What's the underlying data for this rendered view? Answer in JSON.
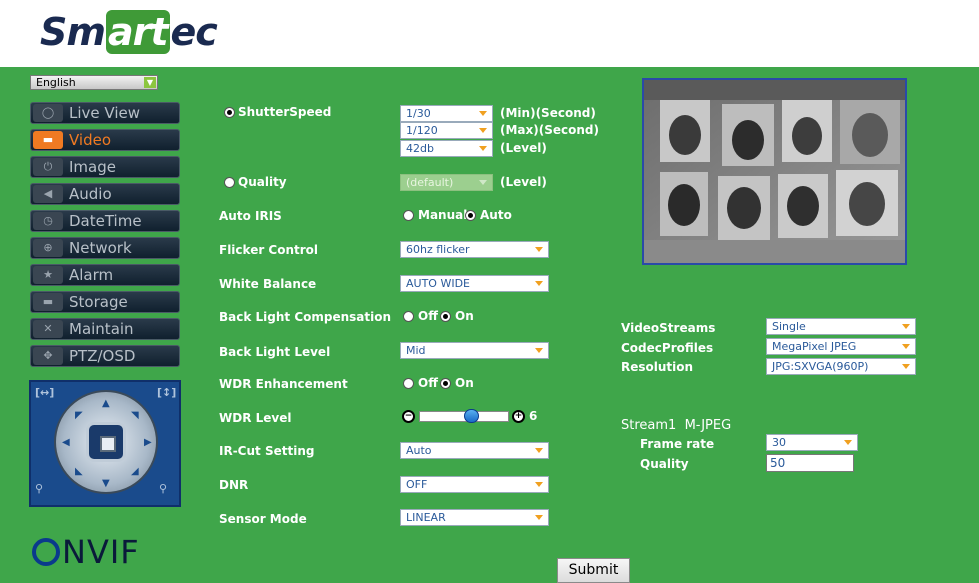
{
  "brand": {
    "logo_pre": "Sm",
    "logo_hl": "art",
    "logo_post": "ec",
    "onvif": "NVIF"
  },
  "language": {
    "value": "English"
  },
  "nav": [
    {
      "label": "Live View",
      "icon": "chat-bubble-icon"
    },
    {
      "label": "Video",
      "icon": "video-camera-icon",
      "active": true
    },
    {
      "label": "Image",
      "icon": "power-icon"
    },
    {
      "label": "Audio",
      "icon": "speaker-icon"
    },
    {
      "label": "DateTime",
      "icon": "clock-icon"
    },
    {
      "label": "Network",
      "icon": "globe-icon"
    },
    {
      "label": "Alarm",
      "icon": "star-icon"
    },
    {
      "label": "Storage",
      "icon": "folder-icon"
    },
    {
      "label": "Maintain",
      "icon": "tools-icon"
    },
    {
      "label": "PTZ/OSD",
      "icon": "move-arrows-icon"
    }
  ],
  "exposure": {
    "shutter_label": "ShutterSpeed",
    "shutter_min": "1/30",
    "shutter_max": "1/120",
    "gain": "42db",
    "min_note": "(Min)(Second)",
    "max_note": "(Max)(Second)",
    "level_note": "(Level)",
    "quality_label": "Quality",
    "quality_value": "(default)",
    "quality_note": "(Level)"
  },
  "settings": {
    "auto_iris": {
      "label": "Auto IRIS",
      "opt1": "Manual",
      "opt2": "Auto"
    },
    "flicker": {
      "label": "Flicker Control",
      "value": "60hz flicker"
    },
    "white_balance": {
      "label": "White Balance",
      "value": "AUTO WIDE"
    },
    "blc": {
      "label": "Back Light Compensation",
      "opt1": "Off",
      "opt2": "On"
    },
    "bl_level": {
      "label": "Back Light Level",
      "value": "Mid"
    },
    "wdr": {
      "label": "WDR Enhancement",
      "opt1": "Off",
      "opt2": "On"
    },
    "wdr_level": {
      "label": "WDR Level",
      "value": "6",
      "fraction": 0.6
    },
    "ircut": {
      "label": "IR-Cut Setting",
      "value": "Auto"
    },
    "dnr": {
      "label": "DNR",
      "value": "OFF"
    },
    "sensor": {
      "label": "Sensor Mode",
      "value": "LINEAR"
    }
  },
  "streams": {
    "video_streams_label": "VideoStreams",
    "video_streams_value": "Single",
    "codec_label": "CodecProfiles",
    "codec_value": "MegaPixel JPEG",
    "resolution_label": "Resolution",
    "resolution_value": "JPG:SXVGA(960P)",
    "stream1_title": "Stream1",
    "stream1_codec": "M-JPEG",
    "frame_rate_label": "Frame rate",
    "frame_rate_value": "30",
    "quality_label": "Quality",
    "quality_value": "50"
  },
  "submit_label": "Submit"
}
